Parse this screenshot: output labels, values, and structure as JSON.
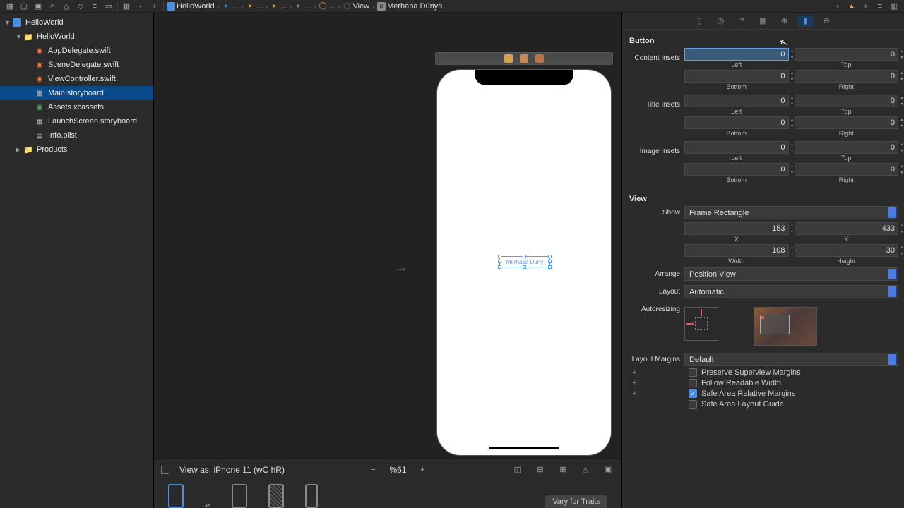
{
  "breadcrumb": {
    "project": "HelloWorld",
    "items": [
      "...",
      "...",
      "...",
      "...",
      "...",
      "View",
      "Merhaba Dünya"
    ]
  },
  "navigator": {
    "project": "HelloWorld",
    "group": "HelloWorld",
    "files": {
      "appdelegate": "AppDelegate.swift",
      "scenedelegate": "SceneDelegate.swift",
      "viewcontroller": "ViewController.swift",
      "mainstory": "Main.storyboard",
      "assets": "Assets.xcassets",
      "launchscreen": "LaunchScreen.storyboard",
      "infoplist": "Info.plist"
    },
    "products": "Products"
  },
  "canvas": {
    "button_text": "Merhaba Düny",
    "view_as": "View as: iPhone 11 (wC hR)",
    "zoom": "%61",
    "vary": "Vary for Traits"
  },
  "inspector": {
    "button_section": "Button",
    "content_insets_label": "Content Insets",
    "content_insets": {
      "left": "0",
      "top": "0",
      "bottom": "0",
      "right": "0"
    },
    "title_insets_label": "Title Insets",
    "title_insets": {
      "left": "0",
      "top": "0",
      "bottom": "0",
      "right": "0"
    },
    "image_insets_label": "Image Insets",
    "image_insets": {
      "left": "0",
      "top": "0",
      "bottom": "0",
      "right": "0"
    },
    "captions": {
      "left": "Left",
      "top": "Top",
      "bottom": "Bottom",
      "right": "Right",
      "x": "X",
      "y": "Y",
      "width": "Width",
      "height": "Height"
    },
    "view_section": "View",
    "show_label": "Show",
    "show_value": "Frame Rectangle",
    "frame": {
      "x": "153",
      "y": "433",
      "width": "108",
      "height": "30"
    },
    "arrange_label": "Arrange",
    "arrange_value": "Position View",
    "layout_label": "Layout",
    "layout_value": "Automatic",
    "autoresizing_label": "Autoresizing",
    "layout_margins_label": "Layout Margins",
    "layout_margins_value": "Default",
    "preserve_superview": "Preserve Superview Margins",
    "follow_readable": "Follow Readable Width",
    "safe_area_relative": "Safe Area Relative Margins",
    "safe_area_guide": "Safe Area Layout Guide"
  }
}
